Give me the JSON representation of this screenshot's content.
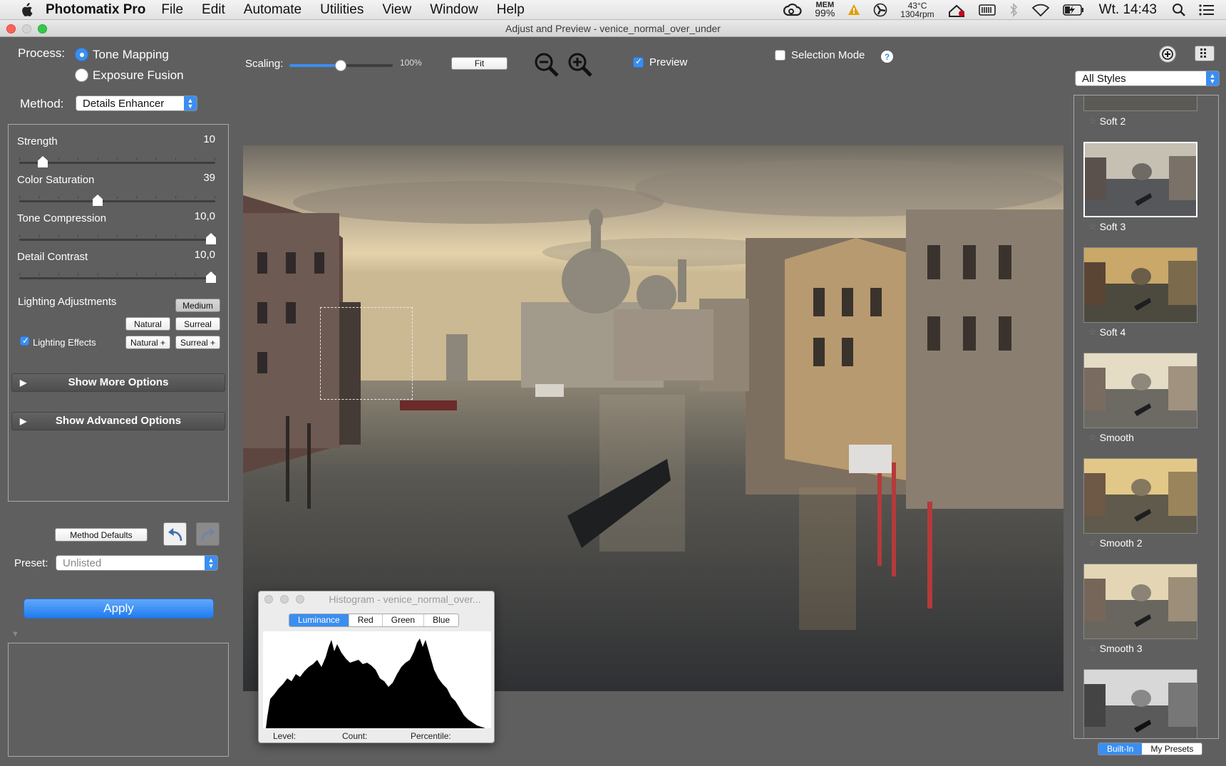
{
  "menubar": {
    "app_name": "Photomatix Pro",
    "menus": [
      "File",
      "Edit",
      "Automate",
      "Utilities",
      "View",
      "Window",
      "Help"
    ],
    "mem_label": "MEM",
    "mem_value": "99%",
    "temp_value": "43°C",
    "fan_value": "1304rpm",
    "clock": "Wt. 14:43"
  },
  "window": {
    "title": "Adjust and Preview - venice_normal_over_under"
  },
  "process": {
    "label": "Process:",
    "options": [
      "Tone Mapping",
      "Exposure Fusion"
    ],
    "selected": "Tone Mapping"
  },
  "method": {
    "label": "Method:",
    "value": "Details Enhancer"
  },
  "toolbar": {
    "scaling_label": "Scaling:",
    "scaling_value": "100%",
    "fit_label": "Fit",
    "preview_label": "Preview",
    "preview_checked": true,
    "selection_mode_label": "Selection Mode",
    "selection_mode_checked": false
  },
  "sliders": [
    {
      "label": "Strength",
      "value": "10",
      "fraction": 0.11
    },
    {
      "label": "Color Saturation",
      "value": "39",
      "fraction": 0.39
    },
    {
      "label": "Tone Compression",
      "value": "10,0",
      "fraction": 1.0
    },
    {
      "label": "Detail Contrast",
      "value": "10,0",
      "fraction": 1.0
    }
  ],
  "lighting": {
    "label": "Lighting Adjustments",
    "medium_label": "Medium",
    "natural_label": "Natural",
    "surreal_label": "Surreal",
    "natural_plus_label": "Natural +",
    "surreal_plus_label": "Surreal +",
    "effects_label": "Lighting Effects",
    "effects_checked": true
  },
  "expanders": {
    "more_options": "Show More Options",
    "advanced_options": "Show Advanced Options"
  },
  "defaults": {
    "method_defaults_label": "Method Defaults"
  },
  "preset": {
    "label": "Preset:",
    "value": "Unlisted"
  },
  "apply_label": "Apply",
  "histogram": {
    "title": "Histogram - venice_normal_over...",
    "tabs": [
      "Luminance",
      "Red",
      "Green",
      "Blue"
    ],
    "active_tab": "Luminance",
    "level_label": "Level:",
    "count_label": "Count:",
    "percentile_label": "Percentile:"
  },
  "styles": {
    "filter_value": "All Styles",
    "items": [
      {
        "name": "Soft 2",
        "tone": "warm"
      },
      {
        "name": "Soft 3",
        "tone": "neutral",
        "selected": true
      },
      {
        "name": "Soft 4",
        "tone": "golden"
      },
      {
        "name": "Smooth",
        "tone": "bright"
      },
      {
        "name": "Smooth 2",
        "tone": "warm"
      },
      {
        "name": "Smooth 3",
        "tone": "bright"
      },
      {
        "name": "",
        "tone": "mono"
      }
    ],
    "preset_tabs": [
      "Built-In",
      "My Presets"
    ],
    "active_preset_tab": "Built-In"
  },
  "colors": {
    "accent": "#3b8ef0",
    "window_bg": "#5f5f5f"
  }
}
